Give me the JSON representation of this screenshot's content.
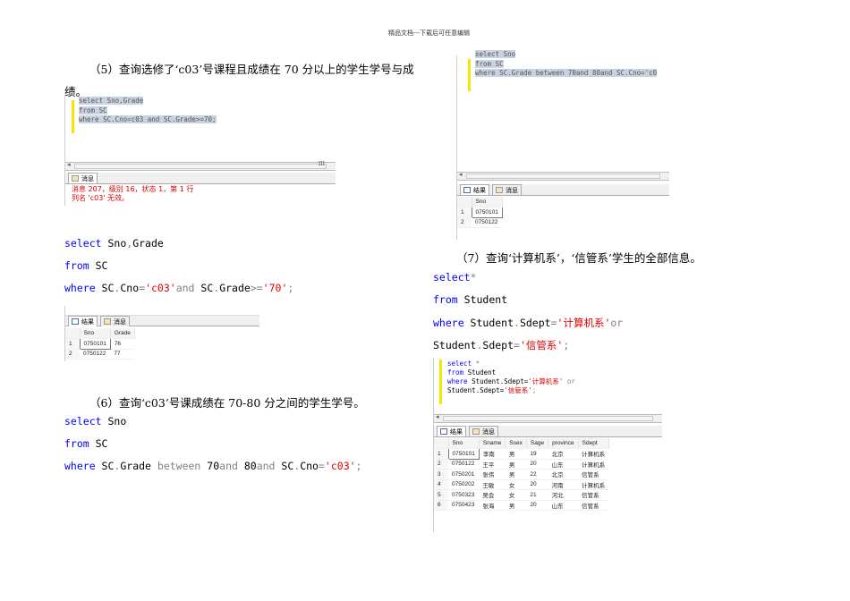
{
  "header": "精品文档---下载后可任意编辑",
  "sec5": {
    "heading_line1": "（5）查询选修了‘c03’号课程且成绩在 70 分以上的学生学号与成",
    "heading_line2": "绩。",
    "shot": {
      "sql": [
        "select Sno,Grade",
        "from SC",
        "where SC.Cno=c03 and SC.Grade>=70;"
      ],
      "tab_messages": "消息",
      "errors": [
        "消息 207，级别 16，状态 1，第 1 行",
        "列名 'c03' 无效。"
      ]
    },
    "code": [
      [
        {
          "t": "select",
          "k": "kw"
        },
        {
          "t": " Sno",
          "k": "tx"
        },
        {
          "t": ",",
          "k": "op"
        },
        {
          "t": "Grade",
          "k": "tx"
        }
      ],
      [
        {
          "t": "from",
          "k": "kw"
        },
        {
          "t": " SC",
          "k": "tx"
        }
      ],
      [
        {
          "t": "where",
          "k": "kw"
        },
        {
          "t": " SC",
          "k": "tx"
        },
        {
          "t": ".",
          "k": "op"
        },
        {
          "t": "Cno",
          "k": "tx"
        },
        {
          "t": "=",
          "k": "op"
        },
        {
          "t": "'c03'",
          "k": "str"
        },
        {
          "t": "and",
          "k": "op"
        },
        {
          "t": " SC",
          "k": "tx"
        },
        {
          "t": ".",
          "k": "op"
        },
        {
          "t": "Grade",
          "k": "tx"
        },
        {
          "t": ">=",
          "k": "op"
        },
        {
          "t": "'70'",
          "k": "str"
        },
        {
          "t": ";",
          "k": "op"
        }
      ]
    ],
    "result": {
      "tab_results": "结果",
      "tab_messages": "消息",
      "columns": [
        "Sno",
        "Grade"
      ],
      "rows": [
        [
          "1",
          "0750101",
          "76"
        ],
        [
          "2",
          "0750122",
          "77"
        ]
      ]
    }
  },
  "sec6": {
    "heading": "（6）查询‘c03’号课成绩在 70-80 分之间的学生学号。",
    "code": [
      [
        {
          "t": "select",
          "k": "kw"
        },
        {
          "t": " Sno",
          "k": "tx"
        }
      ],
      [
        {
          "t": "from",
          "k": "kw"
        },
        {
          "t": " SC",
          "k": "tx"
        }
      ],
      [
        {
          "t": "where",
          "k": "kw"
        },
        {
          "t": " SC",
          "k": "tx"
        },
        {
          "t": ".",
          "k": "op"
        },
        {
          "t": "Grade ",
          "k": "tx"
        },
        {
          "t": "between",
          "k": "op"
        },
        {
          "t": " 70",
          "k": "tx"
        },
        {
          "t": "and",
          "k": "op"
        },
        {
          "t": " 80",
          "k": "tx"
        },
        {
          "t": "and",
          "k": "op"
        },
        {
          "t": " SC",
          "k": "tx"
        },
        {
          "t": ".",
          "k": "op"
        },
        {
          "t": "Cno",
          "k": "tx"
        },
        {
          "t": "=",
          "k": "op"
        },
        {
          "t": "'c03'",
          "k": "str"
        },
        {
          "t": ";",
          "k": "op"
        }
      ]
    ],
    "shot": {
      "sql": [
        "select Sno",
        "from SC",
        "where SC.Grade between 70and 80and SC.Cno='c0"
      ],
      "result": {
        "tab_results": "结果",
        "tab_messages": "消息",
        "columns": [
          "Sno"
        ],
        "rows": [
          [
            "1",
            "0750101"
          ],
          [
            "2",
            "0750122"
          ]
        ]
      }
    }
  },
  "sec7": {
    "heading": "（7）查询‘计算机系’，‘信管系’学生的全部信息。",
    "code": [
      [
        {
          "t": "select",
          "k": "kw"
        },
        {
          "t": "*",
          "k": "op"
        }
      ],
      [
        {
          "t": "from",
          "k": "kw"
        },
        {
          "t": " Student",
          "k": "tx"
        }
      ],
      [
        {
          "t": "where",
          "k": "kw"
        },
        {
          "t": " Student",
          "k": "tx"
        },
        {
          "t": ".",
          "k": "op"
        },
        {
          "t": "Sdept",
          "k": "tx"
        },
        {
          "t": "=",
          "k": "op"
        },
        {
          "t": "'计算机系'",
          "k": "str"
        },
        {
          "t": "or",
          "k": "op"
        }
      ],
      [
        {
          "t": "Student",
          "k": "tx"
        },
        {
          "t": ".",
          "k": "op"
        },
        {
          "t": "Sdept",
          "k": "tx"
        },
        {
          "t": "=",
          "k": "op"
        },
        {
          "t": "'信管系'",
          "k": "str"
        },
        {
          "t": ";",
          "k": "op"
        }
      ]
    ],
    "shot": {
      "sql": [
        [
          {
            "t": "select",
            "k": "kw"
          },
          {
            "t": " *",
            "k": "op"
          }
        ],
        [
          {
            "t": "from",
            "k": "kw"
          },
          {
            "t": " Student",
            "k": "tx"
          }
        ],
        [
          {
            "t": "where",
            "k": "kw"
          },
          {
            "t": " Student.Sdept=",
            "k": "tx"
          },
          {
            "t": "'计算机系'",
            "k": "str"
          },
          {
            "t": " or",
            "k": "op"
          }
        ],
        [
          {
            "t": "Student.Sdept=",
            "k": "tx"
          },
          {
            "t": "'信管系'",
            "k": "str"
          },
          {
            "t": ";",
            "k": "op"
          }
        ]
      ],
      "result": {
        "tab_results": "结果",
        "tab_messages": "消息",
        "columns": [
          "Sno",
          "Sname",
          "Ssex",
          "Sage",
          "province",
          "Sdept"
        ],
        "rows": [
          [
            "1",
            "0750101",
            "李南",
            "男",
            "19",
            "北京",
            "计算机系"
          ],
          [
            "2",
            "0750122",
            "王平",
            "男",
            "20",
            "山东",
            "计算机系"
          ],
          [
            "3",
            "0750201",
            "张伟",
            "男",
            "22",
            "北京",
            "信管系"
          ],
          [
            "4",
            "0750202",
            "王敏",
            "女",
            "20",
            "河南",
            "计算机系"
          ],
          [
            "5",
            "0750323",
            "吴会",
            "女",
            "21",
            "河北",
            "信管系"
          ],
          [
            "6",
            "0750423",
            "张海",
            "男",
            "20",
            "山东",
            "信管系"
          ]
        ]
      }
    }
  }
}
